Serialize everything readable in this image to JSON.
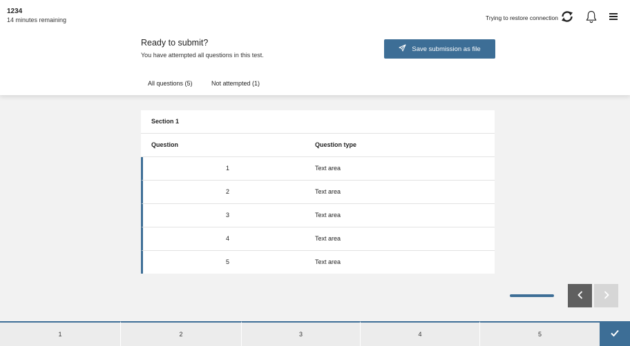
{
  "header": {
    "candidate_id": "1234",
    "time_remaining": "14 minutes remaining",
    "connection_status": "Trying to restore connection",
    "icons": [
      "sync-icon",
      "bell-icon",
      "menu-icon"
    ]
  },
  "submit": {
    "title": "Ready to submit?",
    "subtitle": "You have attempted all questions in this test.",
    "save_button": "Save submission as file"
  },
  "tabs": [
    "All questions (5)",
    "Not attempted (1)"
  ],
  "table": {
    "section_title": "Section 1",
    "columns": [
      "Question",
      "Question type"
    ],
    "rows": [
      {
        "number": "1",
        "type": "Text area"
      },
      {
        "number": "2",
        "type": "Text area"
      },
      {
        "number": "3",
        "type": "Text area"
      },
      {
        "number": "4",
        "type": "Text area"
      },
      {
        "number": "5",
        "type": "Text area"
      }
    ]
  },
  "bottom_nav": [
    "1",
    "2",
    "3",
    "4",
    "5"
  ],
  "colors": {
    "accent": "#3d6e96",
    "background": "#f2f2f2",
    "nav_dark": "#5f5f5f",
    "nav_disabled": "#d6d6d6"
  }
}
